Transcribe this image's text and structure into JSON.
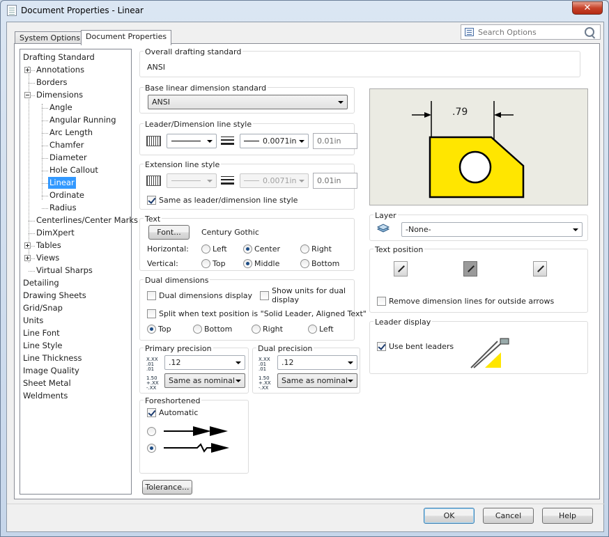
{
  "window": {
    "title": "Document Properties - Linear",
    "close_glyph": "✕"
  },
  "tabs": [
    "System Options",
    "Document Properties"
  ],
  "search": {
    "placeholder": "Search Options"
  },
  "tree": [
    {
      "label": "Drafting Standard",
      "level": 0,
      "expander": "none"
    },
    {
      "label": "Annotations",
      "level": 1,
      "expander": "plus"
    },
    {
      "label": "Borders",
      "level": 1,
      "expander": "none"
    },
    {
      "label": "Dimensions",
      "level": 1,
      "expander": "minus"
    },
    {
      "label": "Angle",
      "level": 2,
      "expander": "none"
    },
    {
      "label": "Angular Running",
      "level": 2,
      "expander": "none"
    },
    {
      "label": "Arc Length",
      "level": 2,
      "expander": "none"
    },
    {
      "label": "Chamfer",
      "level": 2,
      "expander": "none"
    },
    {
      "label": "Diameter",
      "level": 2,
      "expander": "none"
    },
    {
      "label": "Hole Callout",
      "level": 2,
      "expander": "none"
    },
    {
      "label": "Linear",
      "level": 2,
      "expander": "none",
      "selected": true
    },
    {
      "label": "Ordinate",
      "level": 2,
      "expander": "none"
    },
    {
      "label": "Radius",
      "level": 2,
      "expander": "none"
    },
    {
      "label": "Centerlines/Center Marks",
      "level": 1,
      "expander": "none"
    },
    {
      "label": "DimXpert",
      "level": 1,
      "expander": "none"
    },
    {
      "label": "Tables",
      "level": 1,
      "expander": "plus"
    },
    {
      "label": "Views",
      "level": 1,
      "expander": "plus"
    },
    {
      "label": "Virtual Sharps",
      "level": 1,
      "expander": "none"
    },
    {
      "label": "Detailing",
      "level": 0,
      "expander": "none"
    },
    {
      "label": "Drawing Sheets",
      "level": 0,
      "expander": "none"
    },
    {
      "label": "Grid/Snap",
      "level": 0,
      "expander": "none"
    },
    {
      "label": "Units",
      "level": 0,
      "expander": "none"
    },
    {
      "label": "Line Font",
      "level": 0,
      "expander": "none"
    },
    {
      "label": "Line Style",
      "level": 0,
      "expander": "none"
    },
    {
      "label": "Line Thickness",
      "level": 0,
      "expander": "none"
    },
    {
      "label": "Image Quality",
      "level": 0,
      "expander": "none"
    },
    {
      "label": "Sheet Metal",
      "level": 0,
      "expander": "none"
    },
    {
      "label": "Weldments",
      "level": 0,
      "expander": "none"
    }
  ],
  "overall": {
    "label": "Overall drafting standard",
    "value": "ANSI"
  },
  "base_standard": {
    "label": "Base linear dimension standard",
    "value": "ANSI"
  },
  "leader_style": {
    "label": "Leader/Dimension line style",
    "thickness": "0.0071in",
    "custom": "0.01in"
  },
  "extension_style": {
    "label": "Extension line style",
    "thickness": "0.0071in",
    "custom": "0.01in",
    "same_as": "Same as leader/dimension line style"
  },
  "text": {
    "label": "Text",
    "font_button": "Font...",
    "font_name": "Century Gothic",
    "horizontal_label": "Horizontal:",
    "vertical_label": "Vertical:",
    "horizontal_options": [
      "Left",
      "Center",
      "Right"
    ],
    "horizontal_selected": "Center",
    "vertical_options": [
      "Top",
      "Middle",
      "Bottom"
    ],
    "vertical_selected": "Middle"
  },
  "dual": {
    "label": "Dual dimensions",
    "display": "Dual dimensions display",
    "show_units": "Show units for dual display",
    "split": "Split when text position is \"Solid Leader, Aligned Text\"",
    "positions": [
      "Top",
      "Bottom",
      "Right",
      "Left"
    ],
    "position_selected": "Top"
  },
  "primary_precision": {
    "label": "Primary precision",
    "value": ".12",
    "tolerance": "Same as nominal"
  },
  "dual_precision": {
    "label": "Dual precision",
    "value": ".12",
    "tolerance": "Same as nominal"
  },
  "precision_icons": {
    "value_icon": "X.XX .01 .01",
    "tol_icon": "1.50 +.XX -.XX"
  },
  "foreshortened": {
    "label": "Foreshortened",
    "automatic": "Automatic",
    "selected_option": 2
  },
  "tolerance_button": "Tolerance...",
  "preview": {
    "dimension_text": ".79",
    "fill_color": "#ffe600"
  },
  "layer": {
    "label": "Layer",
    "value": "-None-"
  },
  "text_position": {
    "label": "Text position",
    "remove_lines": "Remove dimension lines for outside arrows"
  },
  "leader_display": {
    "label": "Leader display",
    "bent_leaders": "Use bent leaders"
  },
  "footer": {
    "ok": "OK",
    "cancel": "Cancel",
    "help": "Help"
  }
}
